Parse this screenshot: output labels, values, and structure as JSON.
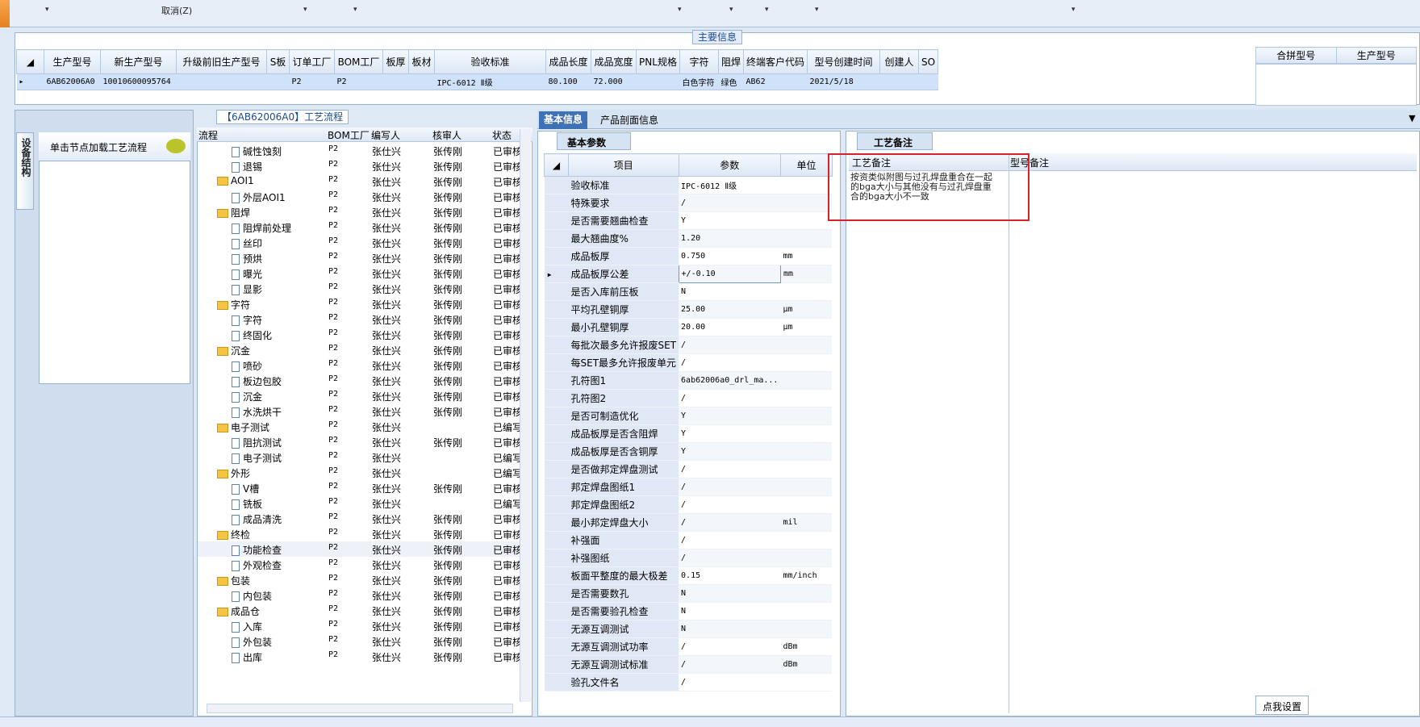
{
  "topbar": {
    "cancel_label": "取消(Z)"
  },
  "main_info": {
    "title": "主要信息",
    "columns": [
      "生产型号",
      "新生产型号",
      "升级前旧生产型号",
      "S板",
      "订单工厂",
      "BOM工厂",
      "板厚",
      "板材",
      "验收标准",
      "成品长度",
      "成品宽度",
      "PNL规格",
      "字符",
      "阻焊",
      "终端客户代码",
      "型号创建时间",
      "创建人",
      "SO"
    ],
    "row": [
      "6AB62006A0",
      "10010600095764",
      "",
      "",
      "P2",
      "P2",
      "",
      "",
      "IPC-6012 Ⅱ级",
      "80.100",
      "72.000",
      "",
      "白色字符",
      "绿色",
      "AB62",
      "2021/5/18",
      "",
      ""
    ],
    "merge_columns": [
      "合拼型号",
      "生产型号"
    ]
  },
  "left": {
    "tab": "设备结构",
    "hint": "单击节点加载工艺流程"
  },
  "process": {
    "title": "【6AB62006A0】工艺流程",
    "columns": [
      "流程",
      "BOM工厂",
      "编写人",
      "核审人",
      "状态"
    ],
    "rows": [
      {
        "name": "碱性蚀刻",
        "type": "doc",
        "f": "P2",
        "w": "张仕兴",
        "r": "张传刚",
        "s": "已审核"
      },
      {
        "name": "退锡",
        "type": "doc",
        "f": "P2",
        "w": "张仕兴",
        "r": "张传刚",
        "s": "已审核"
      },
      {
        "name": "AOI1",
        "type": "folder",
        "f": "P2",
        "w": "张仕兴",
        "r": "张传刚",
        "s": "已审核"
      },
      {
        "name": "外层AOI1",
        "type": "doc",
        "f": "P2",
        "w": "张仕兴",
        "r": "张传刚",
        "s": "已审核"
      },
      {
        "name": "阻焊",
        "type": "folder",
        "f": "P2",
        "w": "张仕兴",
        "r": "张传刚",
        "s": "已审核"
      },
      {
        "name": "阻焊前处理",
        "type": "doc",
        "f": "P2",
        "w": "张仕兴",
        "r": "张传刚",
        "s": "已审核"
      },
      {
        "name": "丝印",
        "type": "doc",
        "f": "P2",
        "w": "张仕兴",
        "r": "张传刚",
        "s": "已审核"
      },
      {
        "name": "预烘",
        "type": "doc",
        "f": "P2",
        "w": "张仕兴",
        "r": "张传刚",
        "s": "已审核"
      },
      {
        "name": "曝光",
        "type": "doc",
        "f": "P2",
        "w": "张仕兴",
        "r": "张传刚",
        "s": "已审核"
      },
      {
        "name": "显影",
        "type": "doc",
        "f": "P2",
        "w": "张仕兴",
        "r": "张传刚",
        "s": "已审核"
      },
      {
        "name": "字符",
        "type": "folder",
        "f": "P2",
        "w": "张仕兴",
        "r": "张传刚",
        "s": "已审核"
      },
      {
        "name": "字符",
        "type": "doc",
        "f": "P2",
        "w": "张仕兴",
        "r": "张传刚",
        "s": "已审核"
      },
      {
        "name": "终固化",
        "type": "doc",
        "f": "P2",
        "w": "张仕兴",
        "r": "张传刚",
        "s": "已审核"
      },
      {
        "name": "沉金",
        "type": "folder",
        "f": "P2",
        "w": "张仕兴",
        "r": "张传刚",
        "s": "已审核"
      },
      {
        "name": "喷砂",
        "type": "doc",
        "f": "P2",
        "w": "张仕兴",
        "r": "张传刚",
        "s": "已审核"
      },
      {
        "name": "板边包胶",
        "type": "doc",
        "f": "P2",
        "w": "张仕兴",
        "r": "张传刚",
        "s": "已审核"
      },
      {
        "name": "沉金",
        "type": "doc",
        "f": "P2",
        "w": "张仕兴",
        "r": "张传刚",
        "s": "已审核"
      },
      {
        "name": "水洗烘干",
        "type": "doc",
        "f": "P2",
        "w": "张仕兴",
        "r": "张传刚",
        "s": "已审核"
      },
      {
        "name": "电子测试",
        "type": "folder",
        "f": "P2",
        "w": "张仕兴",
        "r": "",
        "s": "已编写"
      },
      {
        "name": "阻抗测试",
        "type": "doc",
        "f": "P2",
        "w": "张仕兴",
        "r": "张传刚",
        "s": "已审核"
      },
      {
        "name": "电子测试",
        "type": "doc",
        "f": "P2",
        "w": "张仕兴",
        "r": "",
        "s": "已编写"
      },
      {
        "name": "外形",
        "type": "folder",
        "f": "P2",
        "w": "张仕兴",
        "r": "",
        "s": "已编写"
      },
      {
        "name": "V槽",
        "type": "doc",
        "f": "P2",
        "w": "张仕兴",
        "r": "张传刚",
        "s": "已审核"
      },
      {
        "name": "铣板",
        "type": "doc",
        "f": "P2",
        "w": "张仕兴",
        "r": "",
        "s": "已编写"
      },
      {
        "name": "成品清洗",
        "type": "doc",
        "f": "P2",
        "w": "张仕兴",
        "r": "张传刚",
        "s": "已审核"
      },
      {
        "name": "终检",
        "type": "folder",
        "f": "P2",
        "w": "张仕兴",
        "r": "张传刚",
        "s": "已审核"
      },
      {
        "name": "功能检查",
        "type": "doc",
        "f": "P2",
        "w": "张仕兴",
        "r": "张传刚",
        "s": "已审核"
      },
      {
        "name": "外观检查",
        "type": "doc",
        "f": "P2",
        "w": "张仕兴",
        "r": "张传刚",
        "s": "已审核"
      },
      {
        "name": "包装",
        "type": "folder",
        "f": "P2",
        "w": "张仕兴",
        "r": "张传刚",
        "s": "已审核"
      },
      {
        "name": "内包装",
        "type": "doc",
        "f": "P2",
        "w": "张仕兴",
        "r": "张传刚",
        "s": "已审核"
      },
      {
        "name": "成品仓",
        "type": "folder",
        "f": "P2",
        "w": "张仕兴",
        "r": "张传刚",
        "s": "已审核"
      },
      {
        "name": "入库",
        "type": "doc",
        "f": "P2",
        "w": "张仕兴",
        "r": "张传刚",
        "s": "已审核"
      },
      {
        "name": "外包装",
        "type": "doc",
        "f": "P2",
        "w": "张仕兴",
        "r": "张传刚",
        "s": "已审核"
      },
      {
        "name": "出库",
        "type": "doc",
        "f": "P2",
        "w": "张仕兴",
        "r": "张传刚",
        "s": "已审核"
      }
    ]
  },
  "tabs": {
    "basic": "基本信息",
    "section": "产品剖面信息"
  },
  "params": {
    "title": "基本参数",
    "columns": [
      "项目",
      "参数",
      "单位"
    ],
    "rows": [
      [
        "验收标准",
        "IPC-6012 Ⅱ级",
        ""
      ],
      [
        "特殊要求",
        "/",
        ""
      ],
      [
        "是否需要翘曲检查",
        "Y",
        ""
      ],
      [
        "最大翘曲度%",
        "1.20",
        ""
      ],
      [
        "成品板厚",
        "0.750",
        "mm"
      ],
      [
        "成品板厚公差",
        "+/-0.10",
        "mm"
      ],
      [
        "是否入库前压板",
        "N",
        ""
      ],
      [
        "平均孔壁铜厚",
        "25.00",
        "μm"
      ],
      [
        "最小孔壁铜厚",
        "20.00",
        "μm"
      ],
      [
        "每批次最多允许报废SET",
        "/",
        ""
      ],
      [
        "每SET最多允许报废单元",
        "/",
        ""
      ],
      [
        "孔符图1",
        "6ab62006a0_drl_ma...",
        ""
      ],
      [
        "孔符图2",
        "/",
        ""
      ],
      [
        "是否可制造优化",
        "Y",
        ""
      ],
      [
        "成品板厚是否含阻焊",
        "Y",
        ""
      ],
      [
        "成品板厚是否含铜厚",
        "Y",
        ""
      ],
      [
        "是否做邦定焊盘测试",
        "/",
        ""
      ],
      [
        "邦定焊盘图纸1",
        "/",
        ""
      ],
      [
        "邦定焊盘图纸2",
        "/",
        ""
      ],
      [
        "最小邦定焊盘大小",
        "/",
        "mil"
      ],
      [
        "补强面",
        "/",
        ""
      ],
      [
        "补强图纸",
        "/",
        ""
      ],
      [
        "板面平整度的最大极差",
        "0.15",
        "mm/inch"
      ],
      [
        "是否需要数孔",
        "N",
        ""
      ],
      [
        "是否需要验孔检查",
        "N",
        ""
      ],
      [
        "无源互调测试",
        "N",
        ""
      ],
      [
        "无源互调测试功率",
        "/",
        "dBm"
      ],
      [
        "无源互调测试标准",
        "/",
        "dBm"
      ],
      [
        "验孔文件名",
        "/",
        ""
      ]
    ]
  },
  "remarks": {
    "title": "工艺备注",
    "col1": "工艺备注",
    "col2": "型号备注",
    "text": "按资类似附图与过孔焊盘重合在一起的bga大小与其他没有与过孔焊盘重合的bga大小不一致"
  },
  "settings_button": "点我设置",
  "colors": {
    "accent": "#3f72b5",
    "highlight": "#d8232a",
    "selected_row": "#cfe2fa"
  }
}
